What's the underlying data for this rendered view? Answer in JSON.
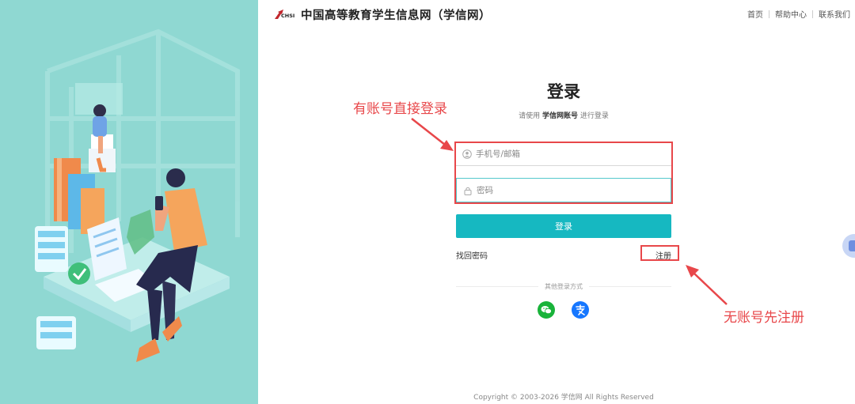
{
  "header": {
    "logo_text": "CHSI",
    "site_title": "中国高等教育学生信息网（学信网）",
    "nav": [
      {
        "label": "首页"
      },
      {
        "label": "帮助中心"
      },
      {
        "label": "联系我们"
      }
    ]
  },
  "login": {
    "title": "登录",
    "subtitle_prefix": "请使用",
    "subtitle_account": "学信网账号",
    "subtitle_suffix": "进行登录",
    "username_placeholder": "手机号/邮箱",
    "password_placeholder": "密码",
    "submit_label": "登录",
    "forgot_label": "找回密码",
    "register_label": "注册",
    "other_methods_label": "其他登录方式",
    "social": [
      {
        "name": "wechat",
        "icon": "wechat-icon",
        "color": "#19b33a"
      },
      {
        "name": "alipay",
        "icon": "alipay-icon",
        "color": "#1677ff"
      }
    ]
  },
  "footer": {
    "copyright": "Copyright © 2003-2026  学信网  All Rights Reserved"
  },
  "annotations": {
    "have_account": "有账号直接登录",
    "no_account": "无账号先注册",
    "color": "#e8474a"
  },
  "colors": {
    "accent": "#16b8c1",
    "hero_bg": "#8fd8d2"
  }
}
